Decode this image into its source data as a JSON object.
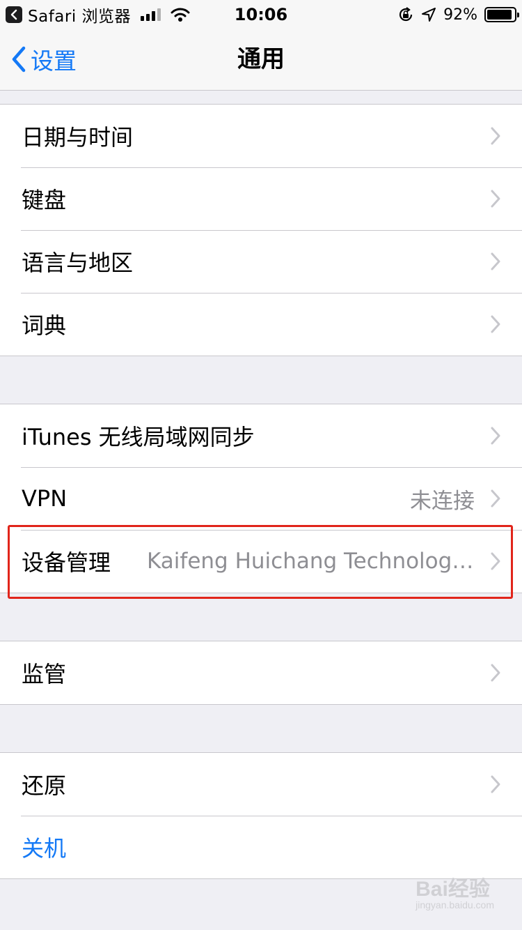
{
  "status_bar": {
    "back_app": "Safari 浏览器",
    "time": "10:06",
    "battery_percent": "92%",
    "battery_level": 0.92,
    "icons": [
      "back-icon",
      "signal-icon",
      "wifi-icon",
      "rotation-lock-icon",
      "location-icon",
      "battery-icon"
    ]
  },
  "nav": {
    "back_label": "设置",
    "title": "通用"
  },
  "groups": [
    {
      "rows": [
        {
          "label": "日期与时间"
        },
        {
          "label": "键盘"
        },
        {
          "label": "语言与地区"
        },
        {
          "label": "词典"
        }
      ]
    },
    {
      "rows": [
        {
          "label": "iTunes 无线局域网同步"
        },
        {
          "label": "VPN",
          "value": "未连接"
        },
        {
          "label": "设备管理",
          "value": "Kaifeng Huichang Technology…"
        }
      ]
    },
    {
      "rows": [
        {
          "label": "监管"
        }
      ]
    },
    {
      "rows": [
        {
          "label": "还原"
        },
        {
          "label": "关机"
        }
      ]
    }
  ],
  "watermark": {
    "text": "Bai经验",
    "subtext": "jingyan.baidu.com"
  },
  "colors": {
    "accent": "#1479f6",
    "highlight": "#e1251b",
    "background": "#efeff4"
  }
}
